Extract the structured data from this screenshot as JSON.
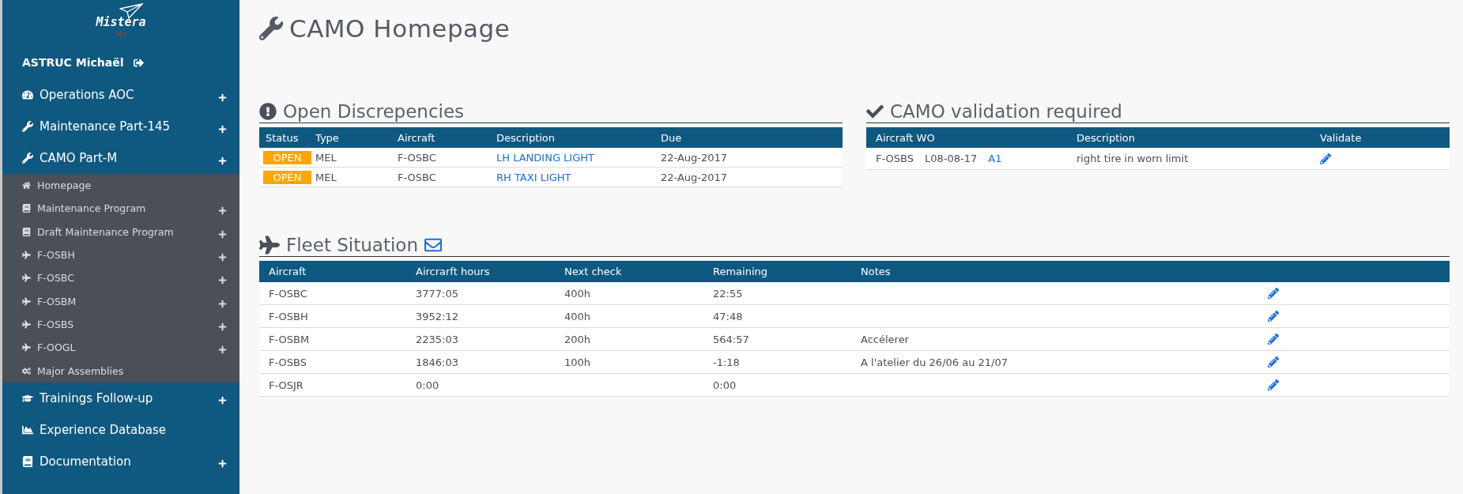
{
  "logo": {
    "name": "Mistera",
    "tag": "DEV"
  },
  "user": {
    "name": "ASTRUC Michaël"
  },
  "sidebar": {
    "items": [
      {
        "label": "Operations AOC",
        "expandable": true,
        "expanded": false
      },
      {
        "label": "Maintenance Part-145",
        "expandable": true,
        "expanded": false
      },
      {
        "label": "CAMO Part-M",
        "expandable": true,
        "expanded": true,
        "children": [
          {
            "label": "Homepage",
            "expandable": false
          },
          {
            "label": "Maintenance Program",
            "expandable": true
          },
          {
            "label": "Draft Maintenance Program",
            "expandable": true
          },
          {
            "label": "F-OSBH",
            "expandable": true
          },
          {
            "label": "F-OSBC",
            "expandable": true
          },
          {
            "label": "F-OSBM",
            "expandable": true
          },
          {
            "label": "F-OSBS",
            "expandable": true
          },
          {
            "label": "F-OOGL",
            "expandable": true
          },
          {
            "label": "Major Assemblies",
            "expandable": false
          }
        ]
      },
      {
        "label": "Trainings Follow-up",
        "expandable": true,
        "expanded": false
      },
      {
        "label": "Experience Database",
        "expandable": false,
        "expanded": false
      },
      {
        "label": "Documentation",
        "expandable": true,
        "expanded": false
      }
    ]
  },
  "page_title": "CAMO Homepage",
  "discrepancies": {
    "title": "Open Discrepencies",
    "columns": [
      "Status",
      "Type",
      "Aircraft",
      "Description",
      "Due"
    ],
    "rows": [
      {
        "status": "OPEN",
        "type": "MEL",
        "aircraft": "F-OSBC",
        "description": "LH LANDING LIGHT",
        "due": "22-Aug-2017"
      },
      {
        "status": "OPEN",
        "type": "MEL",
        "aircraft": "F-OSBC",
        "description": "RH TAXI LIGHT",
        "due": "22-Aug-2017"
      }
    ]
  },
  "validation": {
    "title": "CAMO validation required",
    "columns": [
      "Aircraft WO",
      "Description",
      "Validate"
    ],
    "rows": [
      {
        "aircraft": "F-OSBS",
        "wo": "L08-08-17",
        "task": "A1",
        "description": "right tire in worn limit"
      }
    ]
  },
  "fleet": {
    "title": "Fleet Situation",
    "columns": [
      "Aircraft",
      "Aircrarft hours",
      "Next check",
      "Remaining",
      "Notes"
    ],
    "rows": [
      {
        "aircraft": "F-OSBC",
        "hours": "3777:05",
        "next_check": "400h",
        "remaining": "22:55"
      },
      {
        "aircraft": "F-OSBH",
        "hours": "3952:12",
        "next_check": "400h",
        "remaining": "47:48"
      },
      {
        "aircraft": "F-OSBM",
        "hours": "2235:03",
        "next_check": "200h",
        "remaining": "564:57",
        "notes": "Accélerer"
      },
      {
        "aircraft": "F-OSBS",
        "hours": "1846:03",
        "next_check": "100h",
        "remaining": "-1:18",
        "notes": "A l'atelier du 26/06 au 21/07"
      },
      {
        "aircraft": "F-OSJR",
        "hours": "0:00",
        "remaining": "0:00"
      }
    ]
  }
}
